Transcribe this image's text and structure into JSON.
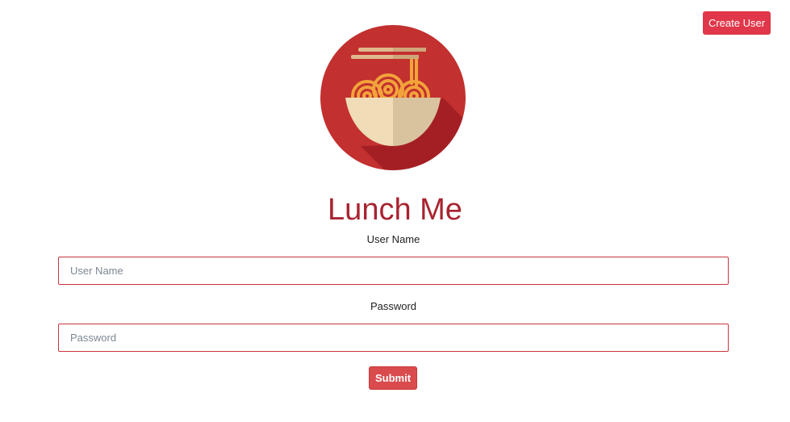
{
  "header": {
    "create_user_label": "Create User"
  },
  "logo": {
    "icon": "noodle-bowl-icon",
    "colors": {
      "circle": "#c2302f",
      "shadow": "#a41f24",
      "bowl_light": "#f0dcb7",
      "bowl_dark": "#d8c39e",
      "noodles": "#f2a33a",
      "chopsticks": "#dfb88c"
    }
  },
  "title": "Lunch Me",
  "form": {
    "username": {
      "label": "User Name",
      "placeholder": "User Name",
      "value": ""
    },
    "password": {
      "label": "Password",
      "placeholder": "Password",
      "value": ""
    },
    "submit_label": "Submit"
  },
  "colors": {
    "accent": "#e0374a",
    "title": "#a82431",
    "input_border": "#c9353d",
    "submit": "#d94b4d"
  }
}
